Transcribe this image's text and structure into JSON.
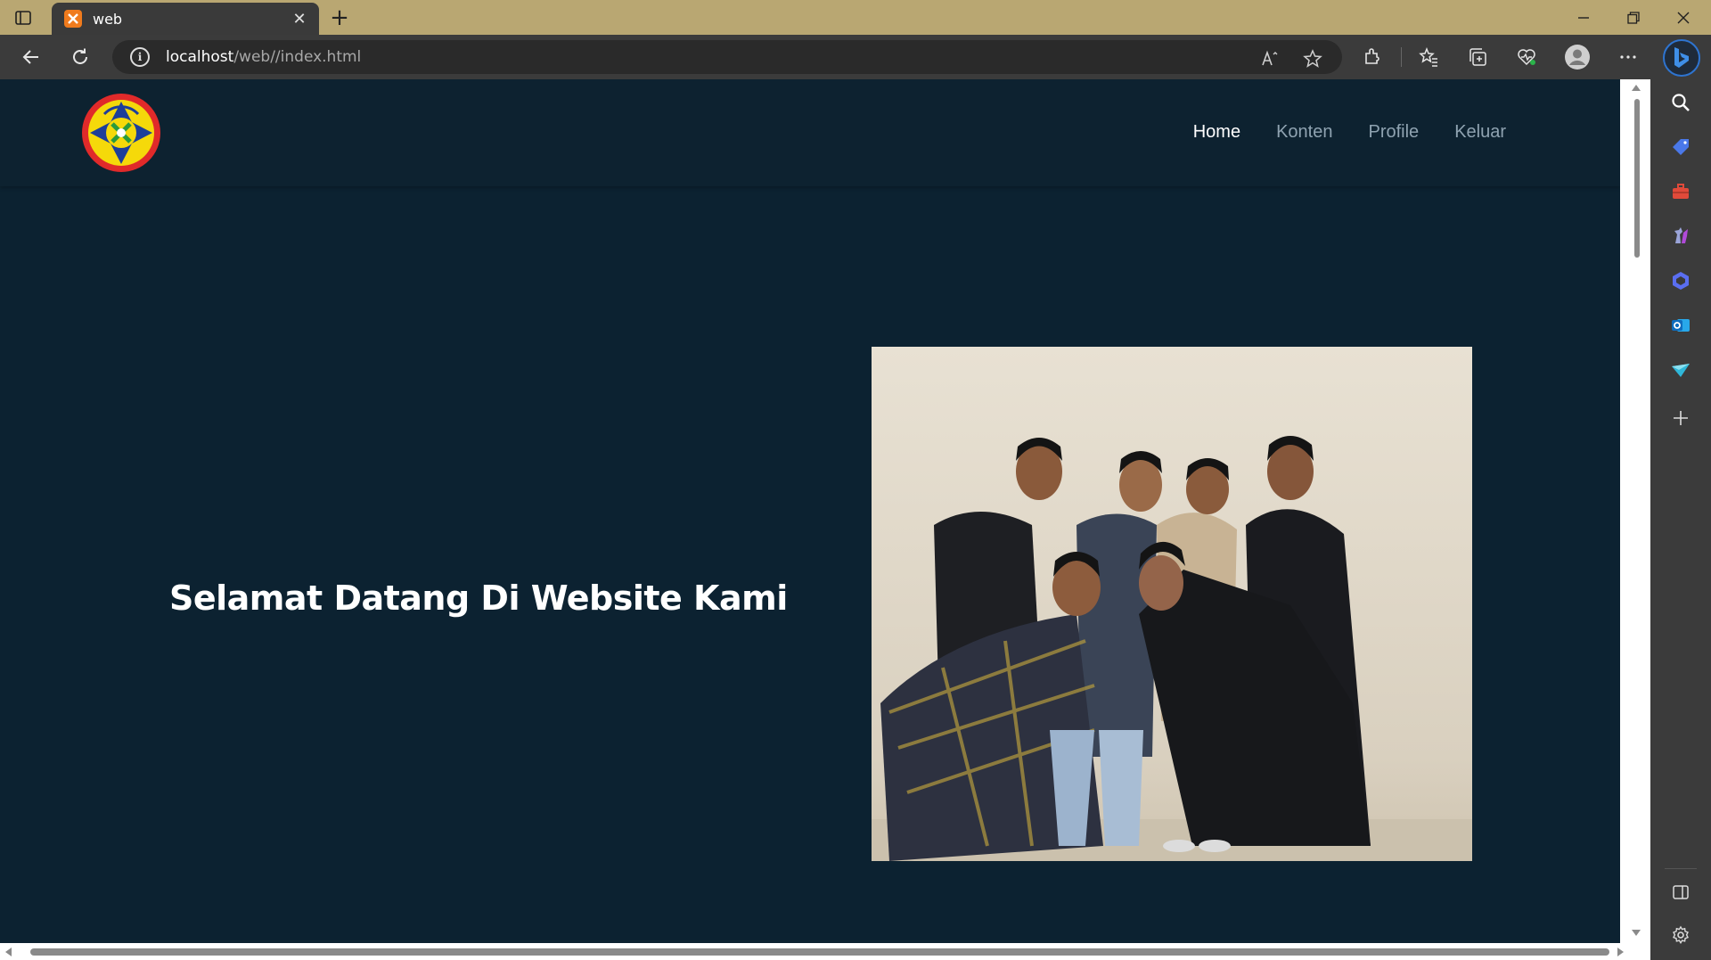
{
  "browser": {
    "tab": {
      "title": "web",
      "favicon": "xampp-icon",
      "close": "✕"
    },
    "new_tab": "+",
    "window_controls": [
      "minimize-icon",
      "restore-icon",
      "close-icon"
    ],
    "address": {
      "host": "localhost",
      "path": "/web//index.html"
    },
    "toolbar_icons": [
      "back-icon",
      "refresh-icon",
      "read-aloud-icon",
      "favorite-star-icon",
      "extensions-icon",
      "favorites-icon",
      "collections-icon",
      "browser-essentials-icon",
      "profile-icon",
      "more-icon",
      "bing-copilot-icon"
    ],
    "sidebar_icons": [
      "search-icon",
      "shopping-tag-icon",
      "tools-icon",
      "games-icon",
      "copilot-icon",
      "outlook-icon",
      "send-icon",
      "add-icon",
      "split-screen-icon",
      "settings-icon"
    ]
  },
  "site": {
    "logo": "school-emblem-logo",
    "nav": [
      {
        "label": "Home",
        "active": true
      },
      {
        "label": "Konten",
        "active": false
      },
      {
        "label": "Profile",
        "active": false
      },
      {
        "label": "Keluar",
        "active": false
      }
    ],
    "hero_title": "Selamat Datang Di Website Kami",
    "hero_image": "group-photo"
  },
  "colors": {
    "titlebar": "#b9a772",
    "toolbar": "#3b3b3b",
    "page_bg": "#0c2231",
    "nav_active": "#ffffff",
    "nav_inactive": "#8fa3b1"
  }
}
